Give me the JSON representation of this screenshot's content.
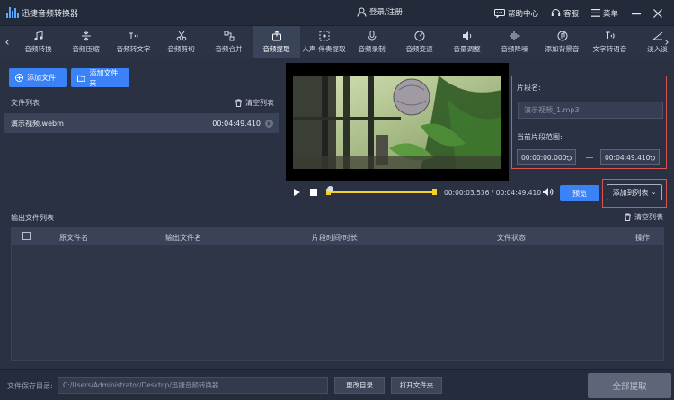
{
  "app": {
    "title": "迅捷音频转换器"
  },
  "titlebar": {
    "login": "登录/注册",
    "help": "帮助中心",
    "service": "客服",
    "menu": "菜单"
  },
  "toolbar": {
    "tools": [
      {
        "label": "音频转换",
        "icon": "music-note-icon"
      },
      {
        "label": "音频压缩",
        "icon": "compress-icon"
      },
      {
        "label": "音频转文字",
        "icon": "audio-to-text-icon"
      },
      {
        "label": "音频剪切",
        "icon": "scissors-icon"
      },
      {
        "label": "音频合并",
        "icon": "merge-icon"
      },
      {
        "label": "音频提取",
        "icon": "extract-icon",
        "active": true
      },
      {
        "label": "人声-伴奏提取",
        "icon": "vocal-separate-icon"
      },
      {
        "label": "音频录制",
        "icon": "microphone-icon"
      },
      {
        "label": "音频变速",
        "icon": "speed-icon"
      },
      {
        "label": "音量调整",
        "icon": "volume-icon"
      },
      {
        "label": "音频降噪",
        "icon": "denoise-icon"
      },
      {
        "label": "添加背景音",
        "icon": "background-music-icon"
      },
      {
        "label": "文字转语音",
        "icon": "text-to-speech-icon"
      },
      {
        "label": "淡入淡",
        "icon": "fade-icon"
      }
    ]
  },
  "left": {
    "add_file": "添加文件",
    "add_folder": "添加文件夹",
    "file_list_label": "文件列表",
    "clear_list": "清空列表",
    "files": [
      {
        "name": "演示视频.webm",
        "duration": "00:04:49.410"
      }
    ]
  },
  "player": {
    "time_current": "00:00:03.536",
    "time_total": "00:04:49.410",
    "time_separator": "/"
  },
  "clip": {
    "name_label": "片段名:",
    "name_value": "演示视频_1.mp3",
    "range_label": "当前片段范围:",
    "start": "00:00:00.000",
    "end": "00:04:49.410",
    "preview": "预览",
    "add_to_list": "添加到列表"
  },
  "output": {
    "title": "输出文件列表",
    "clear": "清空列表",
    "columns": [
      "原文件名",
      "输出文件名",
      "片段时间/时长",
      "文件状态",
      "操作"
    ]
  },
  "bottom": {
    "save_label": "文件保存目录:",
    "save_path": "C:/Users/Administrator/Desktop/迅捷音频转换器",
    "change_dir": "更改目录",
    "open_folder": "打开文件夹",
    "extract_all": "全部提取"
  },
  "colors": {
    "accent": "#3b82f6",
    "highlight_border": "#d9534f",
    "range": "#f2d024"
  }
}
